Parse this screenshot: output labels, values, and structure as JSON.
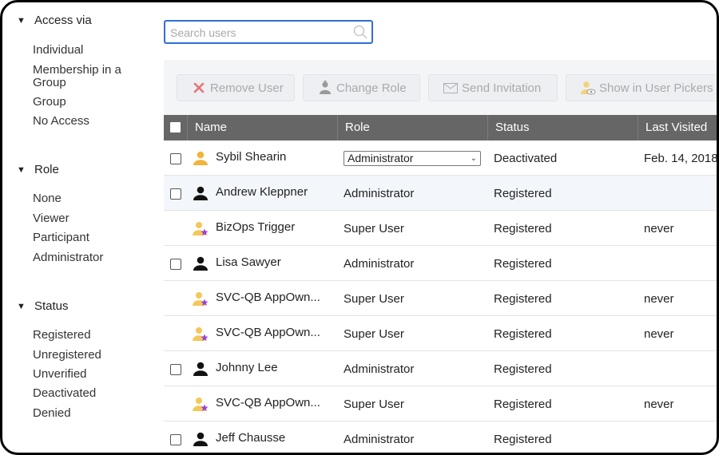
{
  "sidebar": {
    "access": {
      "title": "Access via",
      "options": [
        "Individual",
        "Membership in a Group",
        "Group",
        "No Access"
      ]
    },
    "role": {
      "title": "Role",
      "options": [
        "None",
        "Viewer",
        "Participant",
        "Administrator"
      ]
    },
    "status": {
      "title": "Status",
      "options": [
        "Registered",
        "Unregistered",
        "Unverified",
        "Deactivated",
        "Denied"
      ]
    }
  },
  "search": {
    "placeholder": "Search users",
    "value": ""
  },
  "toolbar": {
    "remove": "Remove User",
    "change_role": "Change Role",
    "send_invite": "Send Invitation",
    "show_pickers": "Show in User Pickers"
  },
  "table": {
    "columns": {
      "name": "Name",
      "role": "Role",
      "status": "Status",
      "last_visited": "Last Visited"
    },
    "rows": [
      {
        "name": "Sybil Shearin",
        "role": "Administrator",
        "status": "Deactivated",
        "last_visited": "Feb. 14, 2018"
      },
      {
        "name": "Andrew Kleppner",
        "role": "Administrator",
        "status": "Registered",
        "last_visited": ""
      },
      {
        "name": "BizOps Trigger",
        "role": "Super User",
        "status": "Registered",
        "last_visited": "never"
      },
      {
        "name": "Lisa Sawyer",
        "role": "Administrator",
        "status": "Registered",
        "last_visited": ""
      },
      {
        "name": "SVC-QB AppOwn...",
        "role": "Super User",
        "status": "Registered",
        "last_visited": "never"
      },
      {
        "name": "SVC-QB AppOwn...",
        "role": "Super User",
        "status": "Registered",
        "last_visited": "never"
      },
      {
        "name": "Johnny Lee",
        "role": "Administrator",
        "status": "Registered",
        "last_visited": ""
      },
      {
        "name": "SVC-QB AppOwn...",
        "role": "Super User",
        "status": "Registered",
        "last_visited": "never"
      },
      {
        "name": "Jeff Chausse",
        "role": "Administrator",
        "status": "Registered",
        "last_visited": ""
      }
    ]
  },
  "colors": {
    "focus": "#2f6fd6",
    "header": "#666666",
    "remove_x": "#e57373",
    "superuser_star": "#9b3fd6",
    "deactivated_user": "#f0b53a"
  }
}
